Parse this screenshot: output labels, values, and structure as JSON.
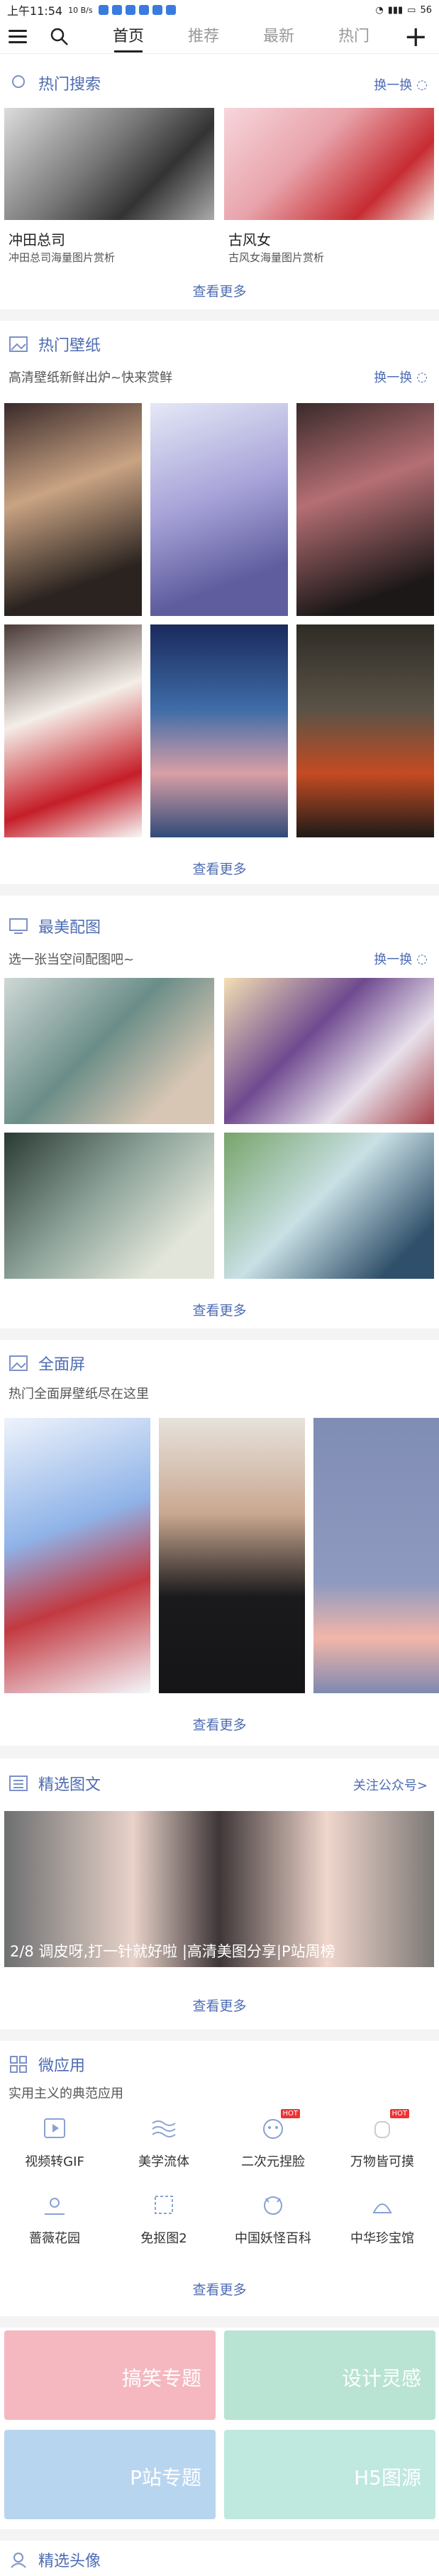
{
  "statusbar": {
    "time": "上午11:54",
    "net": "10 B/s",
    "battery": "56"
  },
  "nav": {
    "tabs": [
      "首页",
      "推荐",
      "最新",
      "热门"
    ]
  },
  "hot_search": {
    "title": "热门搜索",
    "refresh": "换一换",
    "items": [
      {
        "title": "冲田总司",
        "sub": "冲田总司海量图片赏析"
      },
      {
        "title": "古风女",
        "sub": "古风女海量图片赏析"
      }
    ],
    "more": "查看更多"
  },
  "hot_wallpaper": {
    "title": "热门壁纸",
    "sub": "高清壁纸新鲜出炉~快来赏鲜",
    "refresh": "换一换",
    "more": "查看更多"
  },
  "best_pair": {
    "title": "最美配图",
    "sub": "选一张当空间配图吧~",
    "refresh": "换一换",
    "more": "查看更多"
  },
  "fullscreen": {
    "title": "全面屏",
    "sub": "热门全面屏壁纸尽在这里",
    "more": "查看更多"
  },
  "featured": {
    "title": "精选图文",
    "follow": "关注公众号>",
    "banner_caption": "2/8  调皮呀,打一针就好啦 |高清美图分享|P站周榜",
    "more": "查看更多"
  },
  "micro_apps": {
    "title": "微应用",
    "sub": "实用主义的典范应用",
    "hot_label": "HOT",
    "items": [
      {
        "label": "视频转GIF",
        "icon": "video-gif-icon"
      },
      {
        "label": "美学流体",
        "icon": "fluid-icon"
      },
      {
        "label": "二次元捏脸",
        "icon": "face-icon"
      },
      {
        "label": "万物皆可摸",
        "icon": "hand-icon"
      },
      {
        "label": "蔷薇花园",
        "icon": "flower-icon"
      },
      {
        "label": "免抠图2",
        "icon": "cutout-icon"
      },
      {
        "label": "中国妖怪百科",
        "icon": "monster-icon"
      },
      {
        "label": "中华珍宝馆",
        "icon": "treasure-icon"
      }
    ],
    "more": "查看更多"
  },
  "promos": [
    {
      "label": "搞笑专题",
      "color": "#f5b8c0"
    },
    {
      "label": "设计灵感",
      "color": "#b9e3d3"
    },
    {
      "label": "P站专题",
      "color": "#b8d5f0"
    },
    {
      "label": "H5图源",
      "color": "#bfe8df"
    }
  ],
  "avatar_section": {
    "title": "精选头像"
  }
}
